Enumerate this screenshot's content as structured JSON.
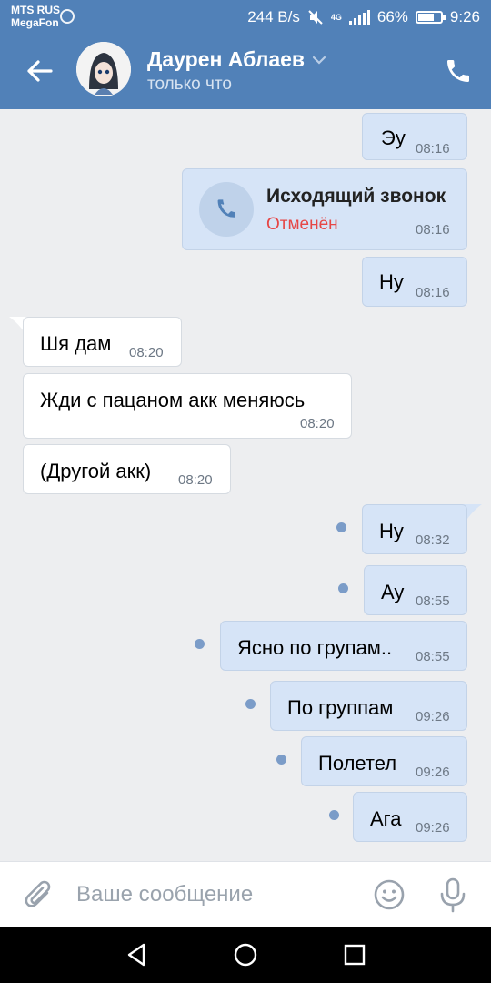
{
  "status_bar": {
    "carrier_1": "MTS RUS",
    "carrier_2": "MegaFon",
    "net_speed": "244 B/s",
    "signal_type": "4G",
    "battery": "66%",
    "time": "9:26"
  },
  "header": {
    "name": "Даурен Аблаев",
    "status": "только что",
    "accent": "#5181b8"
  },
  "messages": [
    {
      "dir": "out",
      "text": "Эу",
      "time": "08:16"
    },
    {
      "dir": "out",
      "type": "call",
      "title": "Исходящий звонок",
      "state": "Отменён",
      "time": "08:16"
    },
    {
      "dir": "out",
      "text": "Ну",
      "time": "08:16"
    },
    {
      "dir": "in",
      "text": "Шя дам",
      "time": "08:20"
    },
    {
      "dir": "in",
      "text": "Жди с пацаном акк меняюсь",
      "time": "08:20"
    },
    {
      "dir": "in",
      "text": "(Другой акк)",
      "time": "08:20"
    },
    {
      "dir": "out",
      "text": "Ну",
      "time": "08:32",
      "unread": true
    },
    {
      "dir": "out",
      "text": "Ау",
      "time": "08:55",
      "unread": true
    },
    {
      "dir": "out",
      "text": "Ясно по групам..",
      "time": "08:55",
      "unread": true
    },
    {
      "dir": "out",
      "text": "По группам",
      "time": "09:26",
      "unread": true
    },
    {
      "dir": "out",
      "text": "Полетел",
      "time": "09:26",
      "unread": true
    },
    {
      "dir": "out",
      "text": "Ага",
      "time": "09:26",
      "unread": true
    }
  ],
  "composer": {
    "placeholder": "Ваше сообщение",
    "icons": [
      "paperclip-icon",
      "emoji-icon",
      "microphone-icon"
    ]
  },
  "nav": {
    "icons": [
      "back-triangle-icon",
      "home-circle-icon",
      "recents-square-icon"
    ]
  }
}
